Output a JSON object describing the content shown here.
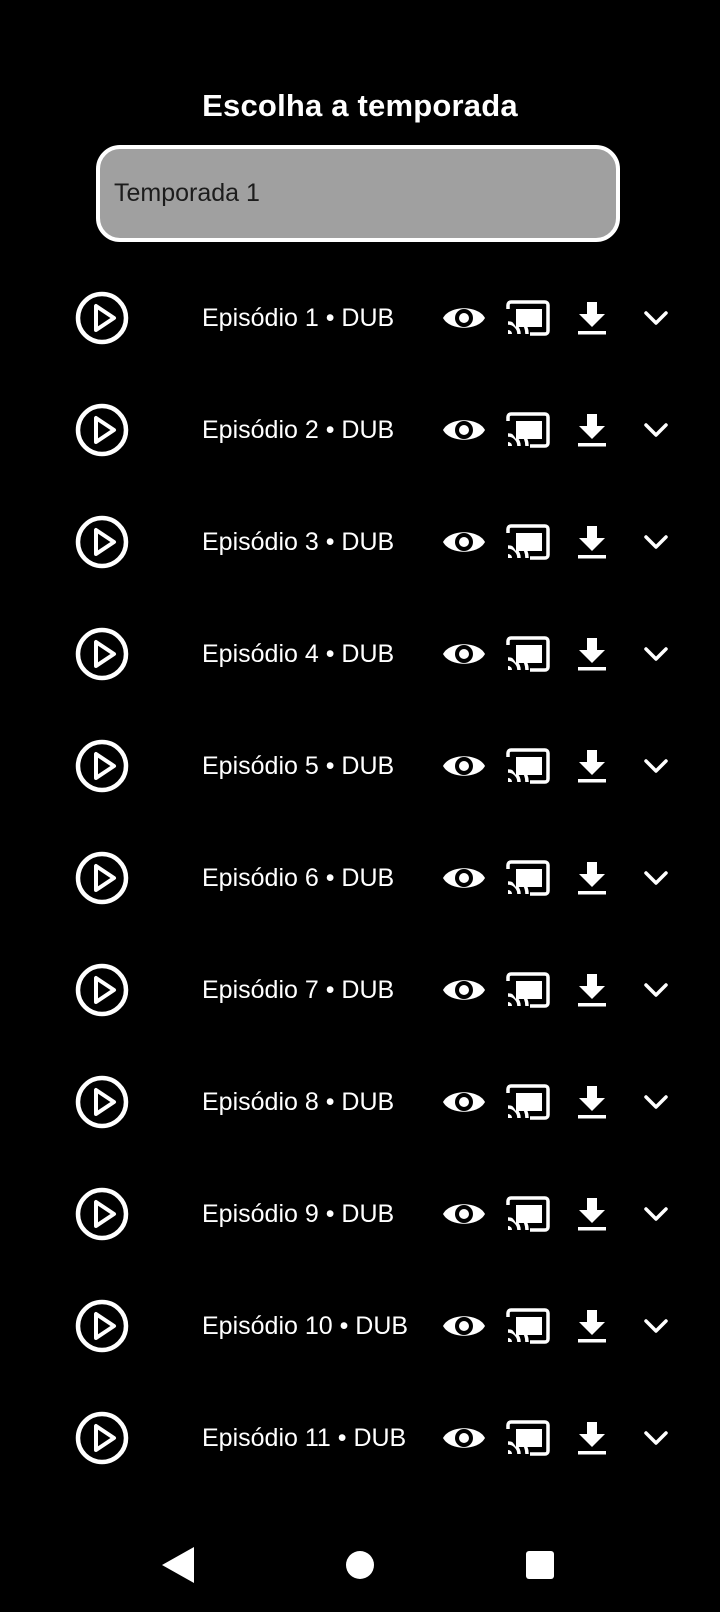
{
  "header": {
    "title": "Escolha a temporada"
  },
  "season_select": {
    "selected": "Temporada 1"
  },
  "episodes": [
    {
      "label": "Episódio 1 • DUB"
    },
    {
      "label": "Episódio 2 • DUB"
    },
    {
      "label": "Episódio 3 • DUB"
    },
    {
      "label": "Episódio 4 • DUB"
    },
    {
      "label": "Episódio 5 • DUB"
    },
    {
      "label": "Episódio 6 • DUB"
    },
    {
      "label": "Episódio 7 • DUB"
    },
    {
      "label": "Episódio 8 • DUB"
    },
    {
      "label": "Episódio 9 • DUB"
    },
    {
      "label": "Episódio 10 • DUB"
    },
    {
      "label": "Episódio 11 • DUB"
    }
  ],
  "row_icons": [
    "play-circle-icon",
    "eye-icon",
    "cast-icon",
    "download-icon",
    "chevron-down-icon"
  ],
  "navbar_icons": [
    "back-triangle-icon",
    "home-circle-icon",
    "recents-square-icon"
  ],
  "colors": {
    "background": "#000000",
    "text": "#ffffff",
    "select_fill": "#a0a0a0",
    "select_text": "#1c1c1c"
  }
}
